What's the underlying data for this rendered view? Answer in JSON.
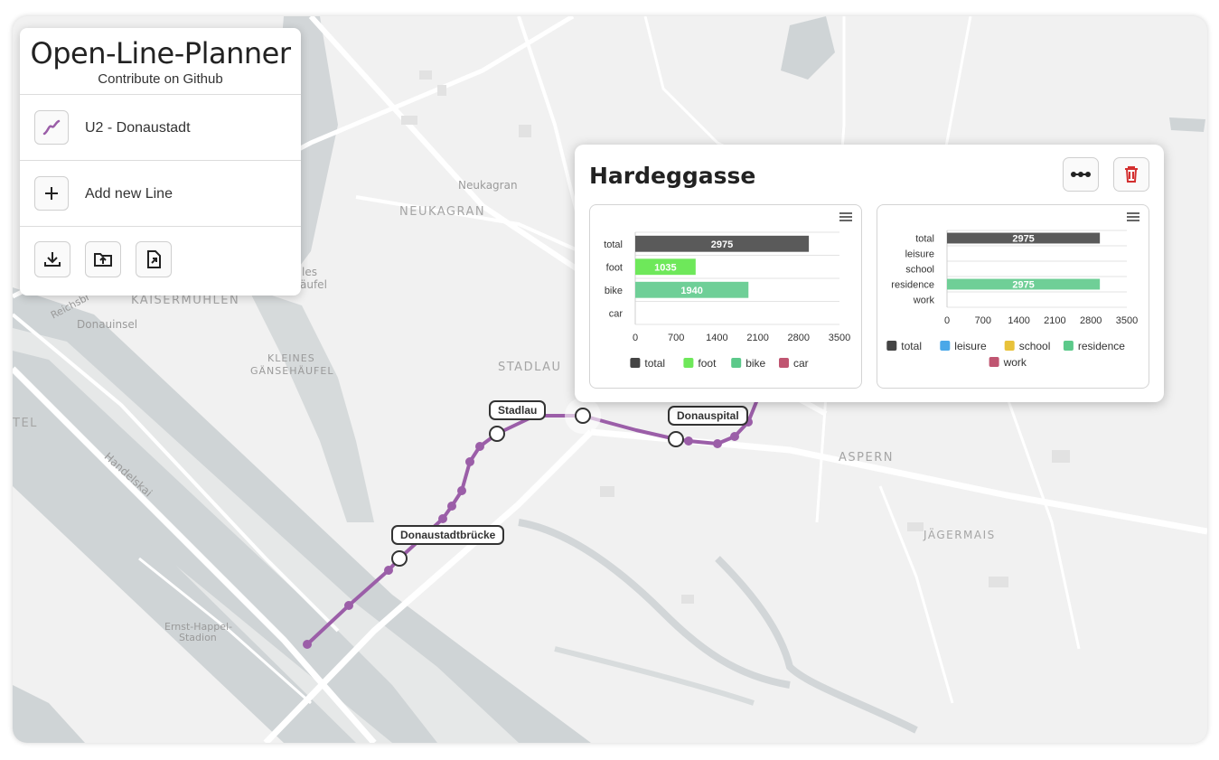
{
  "app": {
    "title": "Open-Line-Planner",
    "subtitle": "Contribute on Github"
  },
  "sidebar": {
    "lines": [
      {
        "label": "U2 - Donaustadt",
        "color": "#9b5ea8",
        "icon": "line-route-icon"
      }
    ],
    "add_line_label": "Add new Line",
    "actions": [
      {
        "icon": "download-icon"
      },
      {
        "icon": "folder-upload-icon"
      },
      {
        "icon": "file-export-icon"
      }
    ]
  },
  "map": {
    "labels": {
      "neukagran_small": "Neukagran",
      "neukagran": "NEUKAGRAN",
      "kaisermuhlen": "KAISERMÜHLEN",
      "donauinsel": "Donauinsel",
      "kleines1": "KLEINES",
      "kleines2": "GÄNSEHÄUFEL",
      "stadlau": "STADLAU",
      "aspern": "ASPERN",
      "jagermais": "JÄGERMAIS",
      "handelskai": "Handelskai",
      "ernst1": "Ernst-Happel-",
      "ernst2": "Stadion",
      "reichsb": "Reichsbr",
      "tel": "TEL",
      "les": "les",
      "aufel": "äufel"
    },
    "route_color": "#9b5ea8",
    "stations": [
      {
        "name": "Stadlau"
      },
      {
        "name": "Donauspital"
      },
      {
        "name": "Donaustadtbrücke"
      }
    ]
  },
  "popup": {
    "title": "Hardeggasse",
    "buttons": [
      {
        "icon": "route-stops-icon",
        "color": "#222222"
      },
      {
        "icon": "trash-icon",
        "color": "#d32f2f"
      }
    ]
  },
  "chart_data": [
    {
      "type": "bar",
      "orientation": "horizontal",
      "categories": [
        "total",
        "foot",
        "bike",
        "car"
      ],
      "values": [
        2975,
        1035,
        1940,
        0
      ],
      "colors": [
        "#5a5a5a",
        "#6ee85a",
        "#6fcf97",
        "#c05571"
      ],
      "xlim": [
        0,
        3500
      ],
      "xticks": [
        "0",
        "700",
        "1400",
        "2100",
        "2800",
        "3500"
      ],
      "legend": [
        "total",
        "foot",
        "bike",
        "car"
      ],
      "legend_colors": [
        "#444444",
        "#6ee85a",
        "#5cc98a",
        "#c05571"
      ],
      "legend_position": "bottom",
      "grid": true
    },
    {
      "type": "bar",
      "orientation": "horizontal",
      "categories": [
        "total",
        "leisure",
        "school",
        "residence",
        "work"
      ],
      "values": [
        2975,
        0,
        0,
        2975,
        0
      ],
      "colors": [
        "#5a5a5a",
        "#4aa8e8",
        "#e8c23a",
        "#6fcf97",
        "#c05571"
      ],
      "xlim": [
        0,
        3500
      ],
      "xticks": [
        "0",
        "700",
        "1400",
        "2100",
        "2800",
        "3500"
      ],
      "legend": [
        "total",
        "leisure",
        "school",
        "residence",
        "work"
      ],
      "legend_colors": [
        "#444444",
        "#4aa8e8",
        "#e8c23a",
        "#5cc98a",
        "#c05571"
      ],
      "legend_position": "bottom",
      "grid": true
    }
  ]
}
